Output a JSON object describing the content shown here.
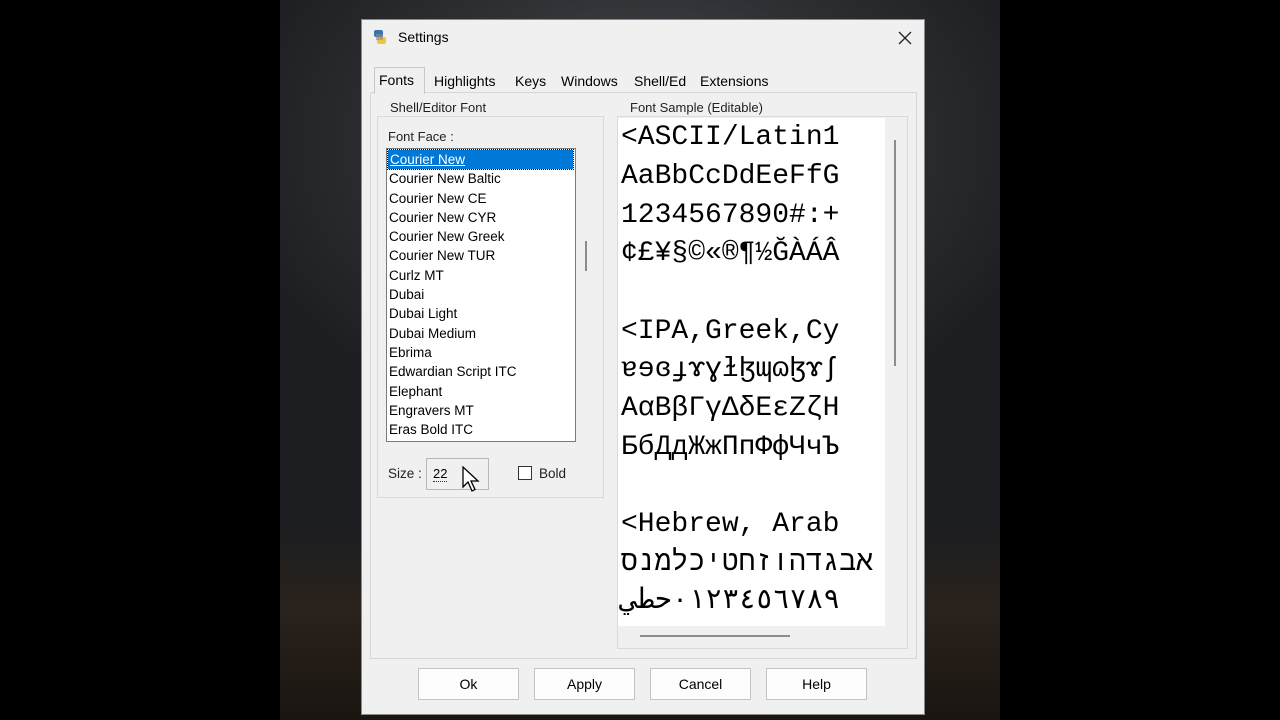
{
  "window": {
    "title": "Settings"
  },
  "tabs": [
    {
      "label": "Fonts",
      "active": true
    },
    {
      "label": "Highlights"
    },
    {
      "label": "Keys"
    },
    {
      "label": "Windows"
    },
    {
      "label": "Shell/Ed"
    },
    {
      "label": "Extensions"
    }
  ],
  "font_group": {
    "title": "Shell/Editor Font",
    "face_label": "Font Face :",
    "fonts": [
      "Courier New",
      "Courier New Baltic",
      "Courier New CE",
      "Courier New CYR",
      "Courier New Greek",
      "Courier New TUR",
      "Curlz MT",
      "Dubai",
      "Dubai Light",
      "Dubai Medium",
      "Ebrima",
      "Edwardian Script ITC",
      "Elephant",
      "Engravers MT",
      "Eras Bold ITC"
    ],
    "selected_font": "Courier New",
    "size_label": "Size :",
    "size_value": "22",
    "bold_label": "Bold",
    "bold_checked": false
  },
  "sample_group": {
    "title": "Font Sample (Editable)",
    "lines": [
      "<ASCII/Latin1",
      "AaBbCcDdEeFfG",
      "1234567890#:+",
      "¢£¥§©«®¶½ĞÀÁÂ",
      "",
      "<IPA,Greek,Cy",
      "ɐɘɞɟɤɣɫɮɰɷɮɤʃ",
      "AαBβΓγΔδEεZζH",
      "БбДдЖжПпФфЧчЪ",
      "",
      "<Hebrew, Arab",
      "אבגדהוזחטיכלמנס",
      "٠١٢٣٤٥٦٧٨٩حطي"
    ]
  },
  "buttons": {
    "ok": "Ok",
    "apply": "Apply",
    "cancel": "Cancel",
    "help": "Help"
  },
  "colors": {
    "selection": "#0078d7",
    "dialog_bg": "#f0f0f0"
  }
}
